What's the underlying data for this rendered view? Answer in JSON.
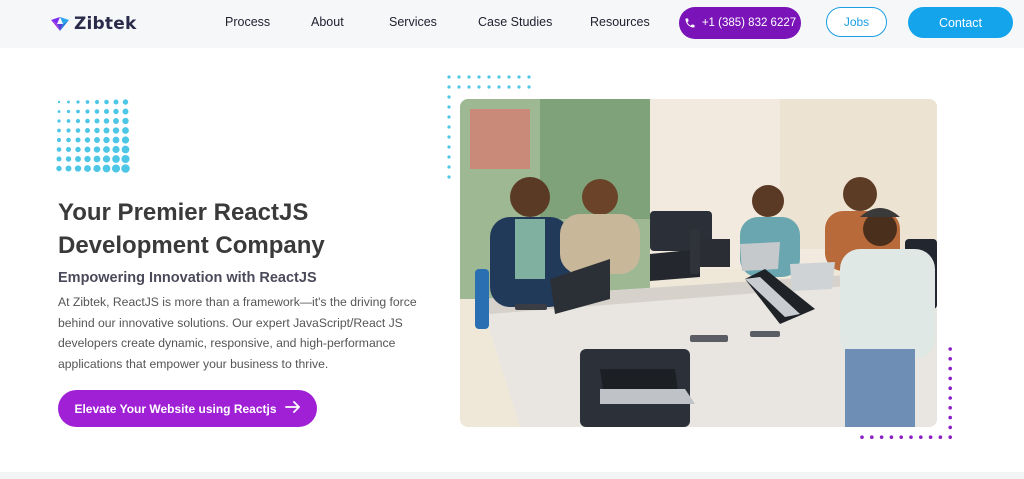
{
  "header": {
    "logo_text": "Zibtek",
    "nav": [
      {
        "label": "Process"
      },
      {
        "label": "About"
      },
      {
        "label": "Services"
      },
      {
        "label": "Case Studies"
      },
      {
        "label": "Resources"
      }
    ],
    "phone": "+1 (385) 832 6227",
    "jobs_label": "Jobs",
    "contact_label": "Contact"
  },
  "hero": {
    "title_line1": "Your Premier ReactJS",
    "title_line2": "Development Company",
    "subtitle": "Empowering Innovation with ReactJS",
    "description": "At Zibtek, ReactJS is more than a framework—it's the driving force behind our innovative solutions. Our expert JavaScript/React JS developers create dynamic, responsive, and high-performance applications that empower your business to thrive.",
    "cta_label": "Elevate Your Website using Reactjs"
  },
  "colors": {
    "accent_purple": "#7a13b8",
    "cta_purple": "#a020d6",
    "accent_blue": "#13a4ec",
    "dot_cyan": "#4ec6e6",
    "dot_purple": "#8a1fc4"
  },
  "icons": {
    "phone": "phone-icon",
    "arrow": "arrow-right-icon",
    "logo": "zibtek-logo-icon"
  }
}
